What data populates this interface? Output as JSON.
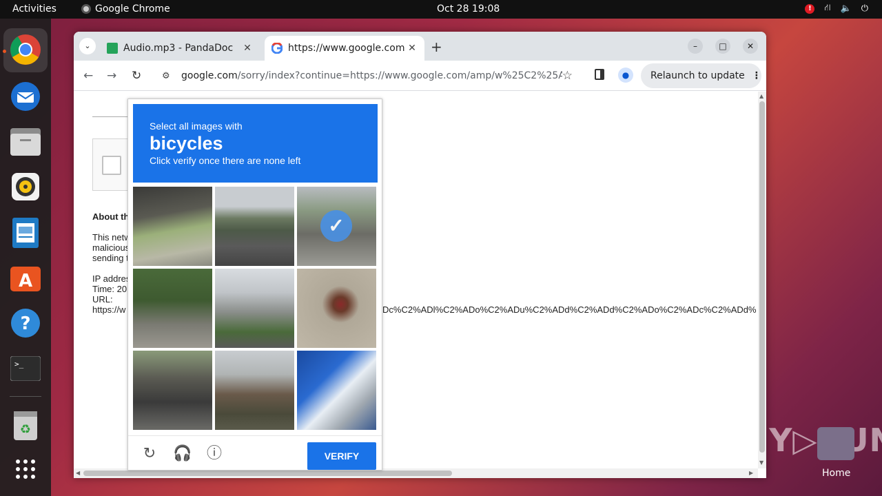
{
  "topbar": {
    "activities": "Activities",
    "app_name": "Google Chrome",
    "clock": "Oct 28  19:08"
  },
  "dock": {
    "items": [
      "chrome-icon",
      "thunderbird-icon",
      "files-icon",
      "rhythmbox-icon",
      "writer-icon",
      "app-center-icon",
      "help-icon",
      "terminal-icon",
      "trash-icon",
      "apps-grid-icon"
    ]
  },
  "desktop": {
    "home_label": "Home",
    "watermark": "ANY▷RUN"
  },
  "browser": {
    "tabs": [
      {
        "title": "Audio.mp3 - PandaDoc"
      },
      {
        "title": "https://www.google.com"
      }
    ],
    "url_domain": "google.com",
    "url_rest": "/sorry/index?continue=https://www.google.com/amp/w%25C2%25ADe...",
    "relaunch_label": "Relaunch to update"
  },
  "page": {
    "about": "About th",
    "p1": [
      "This netw",
      "malicious",
      "sending t"
    ],
    "p2": [
      "IP addres",
      "Time: 20",
      "URL:",
      "https://w"
    ],
    "url_tail": "Dc%C2%ADl%C2%ADo%C2%ADu%C2%ADd%C2%ADd%C2%ADo%C2%ADc%C2%ADd%"
  },
  "captcha": {
    "instruction": "Select all images with",
    "target": "bicycles",
    "subtext": "Click verify once there are none left",
    "verify_label": "VERIFY",
    "selected_tile": 3
  },
  "colors": {
    "accent": "#1a73e8",
    "ubuntu_orange": "#e95420"
  }
}
